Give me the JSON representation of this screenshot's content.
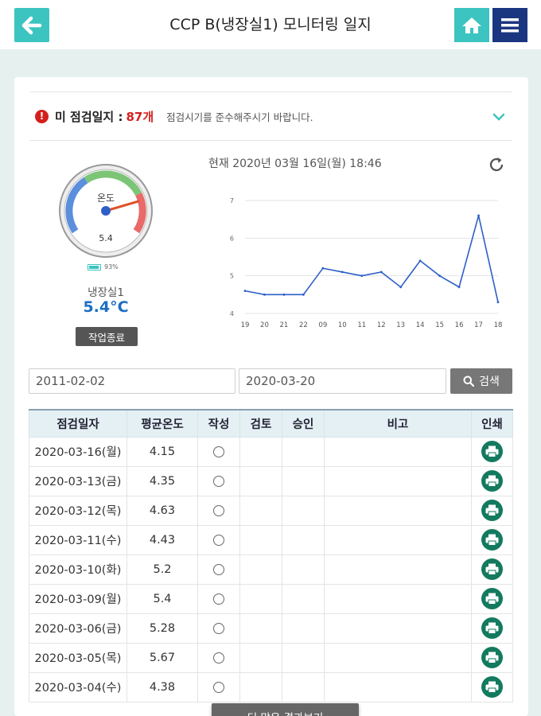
{
  "header": {
    "title": "CCP B(냉장실1) 모니터링 일지",
    "back_icon": "arrow-left-icon",
    "home_icon": "home-icon",
    "menu_icon": "hamburger-menu-icon"
  },
  "notice": {
    "label": "미 점검일지 :",
    "count": "87개",
    "message": "점검시기를 준수해주시기 바랍니다."
  },
  "gauge": {
    "label": "온도",
    "value_text": "5.4",
    "battery": "93%",
    "battery_level": 0.93,
    "room_name": "냉장실1",
    "temperature": "5.4°C",
    "finish_label": "작업종료",
    "colors": {
      "cold": "#5b8fdc",
      "normal": "#7cc576",
      "hot": "#e86a6a",
      "needle": "#e0522b"
    }
  },
  "chart_data": {
    "type": "line",
    "title": "현재 2020년 03월 16일(월) 18:46",
    "categories": [
      "19",
      "20",
      "21",
      "22",
      "09",
      "10",
      "11",
      "12",
      "13",
      "14",
      "15",
      "16",
      "17",
      "18"
    ],
    "values": [
      4.6,
      4.5,
      4.5,
      4.5,
      5.2,
      5.1,
      5.0,
      5.1,
      4.7,
      5.4,
      5.0,
      4.7,
      6.6,
      4.3
    ],
    "yticks": [
      "4",
      "5",
      "6",
      "7"
    ],
    "ylim": [
      4,
      7
    ],
    "grid": true,
    "line_color": "#2e5fc8"
  },
  "search": {
    "from": "2011-02-02",
    "to": "2020-03-20",
    "button_label": "검색"
  },
  "table": {
    "headers": [
      "점검일자",
      "평균온도",
      "작성",
      "검토",
      "승인",
      "비고",
      "인쇄"
    ],
    "rows": [
      {
        "date": "2020-03-16(월)",
        "avg": "4.15"
      },
      {
        "date": "2020-03-13(금)",
        "avg": "4.35"
      },
      {
        "date": "2020-03-12(목)",
        "avg": "4.63"
      },
      {
        "date": "2020-03-11(수)",
        "avg": "4.43"
      },
      {
        "date": "2020-03-10(화)",
        "avg": "5.2"
      },
      {
        "date": "2020-03-09(월)",
        "avg": "5.4"
      },
      {
        "date": "2020-03-06(금)",
        "avg": "5.28"
      },
      {
        "date": "2020-03-05(목)",
        "avg": "5.67"
      },
      {
        "date": "2020-03-04(수)",
        "avg": "4.38"
      }
    ]
  },
  "more_button": "더 많은 결과보기"
}
